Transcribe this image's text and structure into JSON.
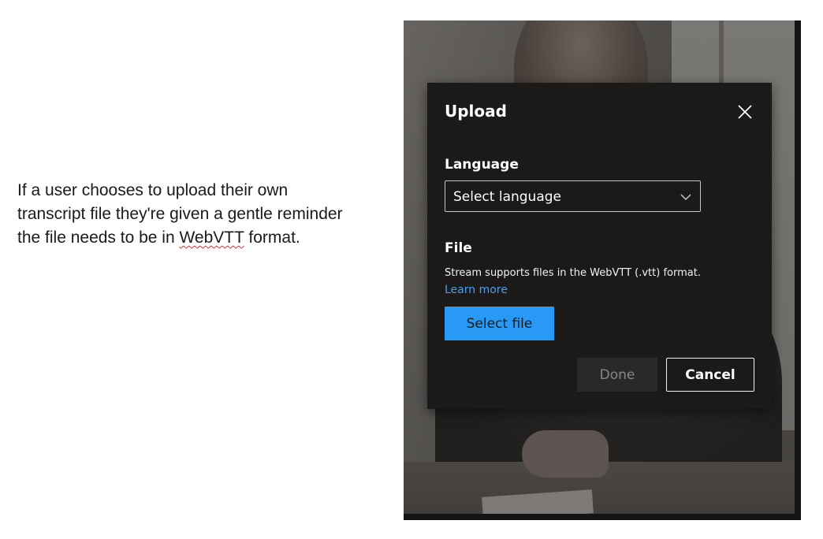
{
  "annotation": {
    "line1": "If a user chooses to upload their own",
    "line2": "transcript file they're given a gentle reminder",
    "line3_prefix": "the file needs to be in ",
    "line3_highlight": "WebVTT",
    "line3_suffix": " format."
  },
  "dialog": {
    "title": "Upload",
    "close_icon": "close-icon",
    "language": {
      "label": "Language",
      "selected_value": "Select language",
      "icon": "chevron-down-icon"
    },
    "file": {
      "label": "File",
      "help_text": "Stream supports files in the WebVTT (.vtt) format.",
      "learn_more": "Learn more",
      "select_button": "Select file"
    },
    "footer": {
      "done_label": "Done",
      "cancel_label": "Cancel"
    }
  },
  "colors": {
    "dialog_bg": "#1b1a19",
    "accent": "#2899f5",
    "link": "#479ef5",
    "disabled_text": "#8a8886"
  }
}
